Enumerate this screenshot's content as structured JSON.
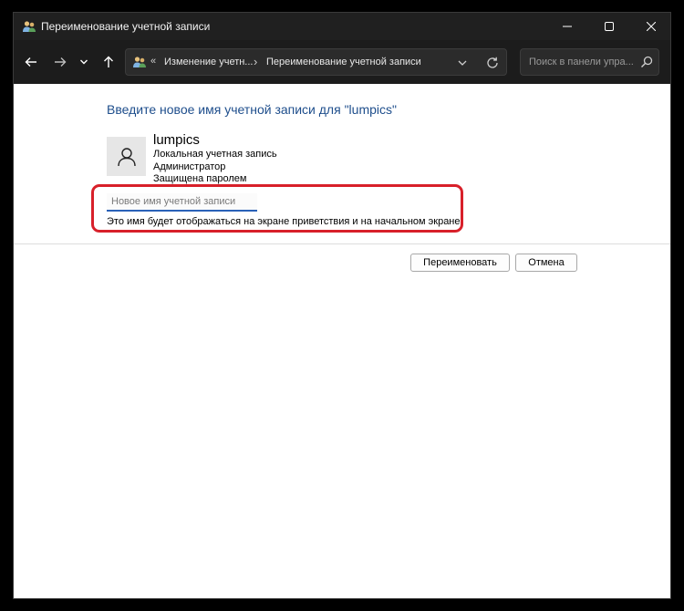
{
  "window": {
    "title": "Переименование учетной записи"
  },
  "navigation": {
    "breadcrumbs": [
      "Изменение учетн...",
      "Переименование учетной записи"
    ],
    "overflow_marker": "«",
    "search_placeholder": "Поиск в панели упра..."
  },
  "main": {
    "heading": "Введите новое имя учетной записи для \"lumpics\"",
    "user": {
      "name": "lumpics",
      "details": [
        "Локальная учетная запись",
        "Администратор",
        "Защищена паролем"
      ]
    },
    "new_name_input": {
      "value": "",
      "placeholder": "Новое имя учетной записи"
    },
    "hint": "Это имя будет отображаться на экране приветствия и на начальном экране.",
    "buttons": {
      "rename": "Переименовать",
      "cancel": "Отмена"
    }
  },
  "colors": {
    "titlebar_bg": "#202020",
    "navbar_bg": "#1c1c1c",
    "heading_text": "#1e4e8c",
    "highlight_border": "#d8202a",
    "input_underline": "#2a62b8"
  },
  "icons": {
    "app": "users-icon",
    "minimize": "minimize-icon",
    "maximize": "maximize-icon",
    "close": "close-icon",
    "back": "arrow-left-icon",
    "forward": "arrow-right-icon",
    "history": "chevron-down-icon",
    "up": "arrow-up-icon",
    "refresh": "refresh-icon",
    "search": "search-icon",
    "avatar": "user-icon"
  }
}
